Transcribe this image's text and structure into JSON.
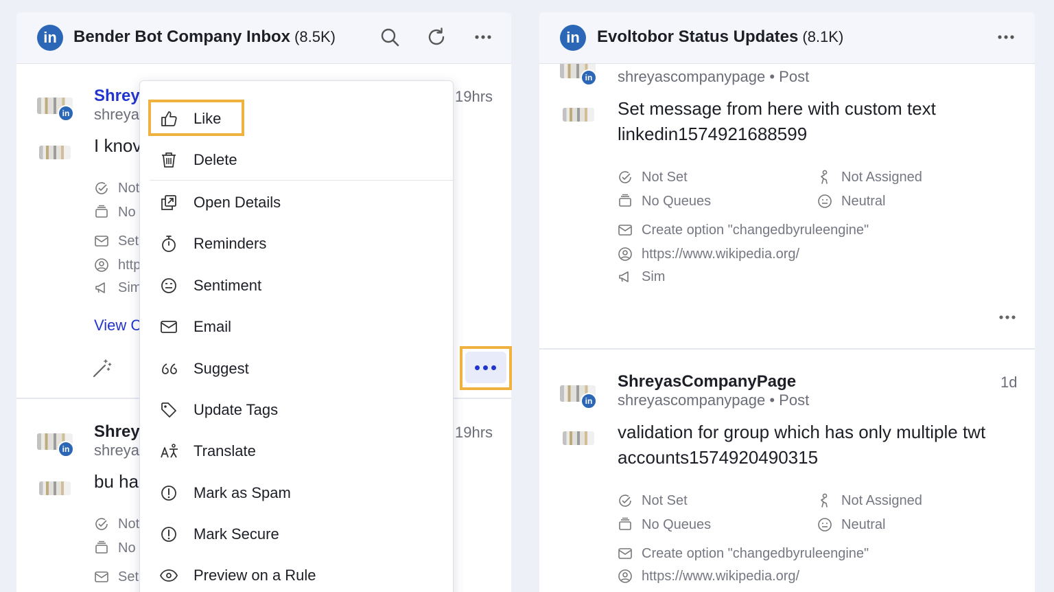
{
  "left_panel": {
    "title": "Bender Bot Company Inbox",
    "count": "(8.5K)",
    "logo": "in",
    "icons": [
      "search-icon",
      "refresh-icon",
      "more-icon"
    ],
    "messages": [
      {
        "author": "Shrey",
        "handle": "shreya",
        "time": "19hrs",
        "text": "I knov",
        "meta": [
          "Not",
          "No",
          "Set",
          "http",
          "Sim"
        ],
        "link": "View C"
      },
      {
        "author": "Shrey",
        "handle": "shreya",
        "time": "19hrs",
        "text": "bu ha",
        "meta": [
          "Not",
          "No",
          "Set"
        ]
      }
    ]
  },
  "dropdown": {
    "items": [
      {
        "label": "Like",
        "icon": "thumbs-up-icon"
      },
      {
        "label": "Delete",
        "icon": "trash-icon"
      },
      {
        "label": "Open Details",
        "icon": "open-details-icon"
      },
      {
        "label": "Reminders",
        "icon": "stopwatch-icon"
      },
      {
        "label": "Sentiment",
        "icon": "sentiment-icon"
      },
      {
        "label": "Email",
        "icon": "email-icon"
      },
      {
        "label": "Suggest",
        "icon": "quote-icon"
      },
      {
        "label": "Update Tags",
        "icon": "tag-icon"
      },
      {
        "label": "Translate",
        "icon": "translate-icon"
      },
      {
        "label": "Mark as Spam",
        "icon": "alert-icon"
      },
      {
        "label": "Mark Secure",
        "icon": "alert-icon"
      },
      {
        "label": "Preview on a Rule",
        "icon": "eye-icon"
      }
    ],
    "highlight_color": "#f0b23e"
  },
  "right_panel": {
    "title": "Evoltobor Status Updates",
    "count": "(8.1K)",
    "logo": "in",
    "posts": [
      {
        "handle_line": "shreyascompanypage • Post",
        "text": "Set message from here with custom text linkedin1574921688599",
        "status": "Not Set",
        "queue": "No Queues",
        "assignee": "Not Assigned",
        "sentiment": "Neutral",
        "option": "Create option \"changedbyruleengine\"",
        "url": "https://www.wikipedia.org/",
        "campaign": "Sim"
      },
      {
        "author": "ShreyasCompanyPage",
        "handle_line": "shreyascompanypage • Post",
        "time": "1d",
        "text": "validation for group which has only multiple twt accounts1574920490315",
        "status": "Not Set",
        "queue": "No Queues",
        "assignee": "Not Assigned",
        "sentiment": "Neutral",
        "option": "Create option \"changedbyruleengine\"",
        "url": "https://www.wikipedia.org/"
      }
    ]
  },
  "colors": {
    "brand_blue": "#2235cc",
    "linkedin_blue": "#2b67b6",
    "background": "#eef0f8",
    "highlight": "#f0b23e"
  }
}
